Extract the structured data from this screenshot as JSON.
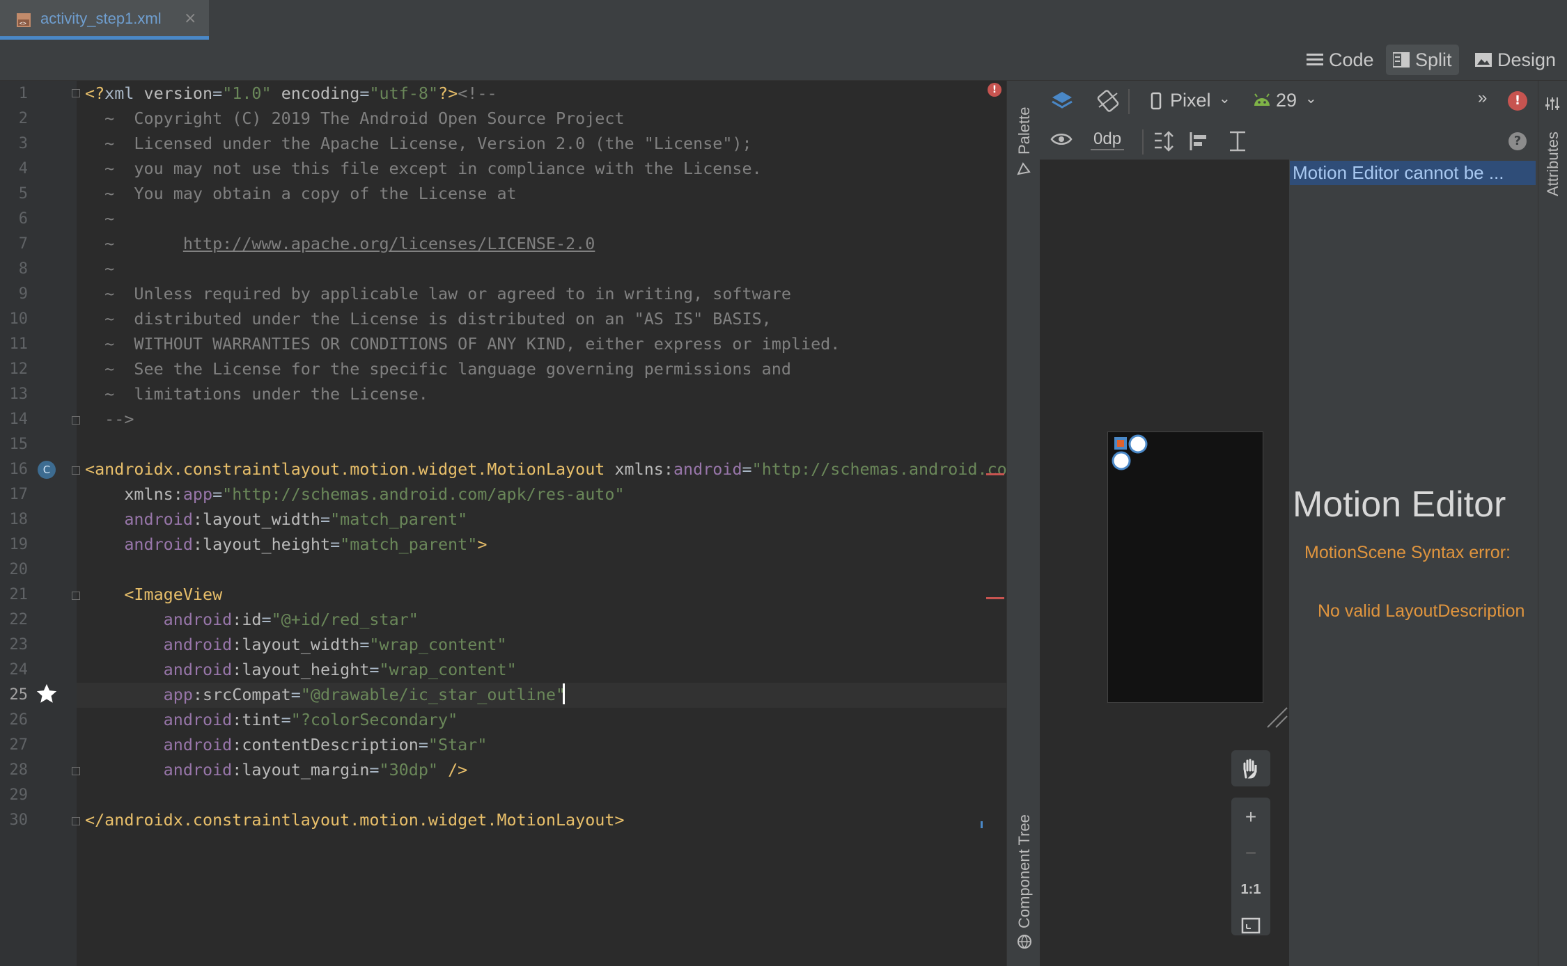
{
  "tab": {
    "filename": "activity_step1.xml",
    "close_icon": "×"
  },
  "modes": {
    "code": "Code",
    "split": "Split",
    "design": "Design"
  },
  "editor": {
    "line_numbers": [
      "1",
      "2",
      "3",
      "4",
      "5",
      "6",
      "7",
      "8",
      "9",
      "10",
      "11",
      "12",
      "13",
      "14",
      "15",
      "16",
      "17",
      "18",
      "19",
      "20",
      "21",
      "22",
      "23",
      "24",
      "25",
      "26",
      "27",
      "28",
      "29",
      "30"
    ],
    "lines": [
      {
        "parts": [
          {
            "t": "<?",
            "c": "tg"
          },
          {
            "t": "xml ",
            "c": ""
          },
          {
            "t": "version",
            "c": "at"
          },
          {
            "t": "=",
            "c": ""
          },
          {
            "t": "\"1.0\"",
            "c": "st"
          },
          {
            "t": " encoding",
            "c": "at"
          },
          {
            "t": "=",
            "c": ""
          },
          {
            "t": "\"utf-8\"",
            "c": "st"
          },
          {
            "t": "?>",
            "c": "tg"
          },
          {
            "t": "<!--",
            "c": "cm"
          }
        ]
      },
      {
        "parts": [
          {
            "t": "  ~  Copyright (C) 2019 The Android Open Source Project",
            "c": "cm"
          }
        ]
      },
      {
        "parts": [
          {
            "t": "  ~  Licensed under the Apache License, Version 2.0 (the \"License\");",
            "c": "cm"
          }
        ]
      },
      {
        "parts": [
          {
            "t": "  ~  you may not use this file except in compliance with the License.",
            "c": "cm"
          }
        ]
      },
      {
        "parts": [
          {
            "t": "  ~  You may obtain a copy of the License at",
            "c": "cm"
          }
        ]
      },
      {
        "parts": [
          {
            "t": "  ~",
            "c": "cm"
          }
        ]
      },
      {
        "parts": [
          {
            "t": "  ~       ",
            "c": "cm"
          },
          {
            "t": "http://www.apache.org/licenses/LICENSE-2.0",
            "c": "lk"
          }
        ]
      },
      {
        "parts": [
          {
            "t": "  ~",
            "c": "cm"
          }
        ]
      },
      {
        "parts": [
          {
            "t": "  ~  Unless required by applicable law or agreed to in writing, software",
            "c": "cm"
          }
        ]
      },
      {
        "parts": [
          {
            "t": "  ~  distributed under the License is distributed on an \"AS IS\" BASIS,",
            "c": "cm"
          }
        ]
      },
      {
        "parts": [
          {
            "t": "  ~  WITHOUT WARRANTIES OR CONDITIONS OF ANY KIND, either express or implied.",
            "c": "cm"
          }
        ]
      },
      {
        "parts": [
          {
            "t": "  ~  See the License for the specific language governing permissions and",
            "c": "cm"
          }
        ]
      },
      {
        "parts": [
          {
            "t": "  ~  limitations under the License.",
            "c": "cm"
          }
        ]
      },
      {
        "parts": [
          {
            "t": "  -->",
            "c": "cm"
          }
        ]
      },
      {
        "parts": [
          {
            "t": "",
            "c": ""
          }
        ]
      },
      {
        "parts": [
          {
            "t": "<androidx.constraintlayout.motion.widget.MotionLayout",
            "c": "tg"
          },
          {
            "t": " xmlns:",
            "c": "at"
          },
          {
            "t": "android",
            "c": "ns"
          },
          {
            "t": "=",
            "c": ""
          },
          {
            "t": "\"http://schemas.android.com",
            "c": "st"
          }
        ]
      },
      {
        "parts": [
          {
            "t": "    xmlns:",
            "c": "at"
          },
          {
            "t": "app",
            "c": "ns"
          },
          {
            "t": "=",
            "c": ""
          },
          {
            "t": "\"http://schemas.android.com/apk/res-auto\"",
            "c": "st"
          }
        ]
      },
      {
        "parts": [
          {
            "t": "    android",
            "c": "ns"
          },
          {
            "t": ":layout_width",
            "c": "at"
          },
          {
            "t": "=",
            "c": ""
          },
          {
            "t": "\"match_parent\"",
            "c": "st"
          }
        ]
      },
      {
        "parts": [
          {
            "t": "    android",
            "c": "ns"
          },
          {
            "t": ":layout_height",
            "c": "at"
          },
          {
            "t": "=",
            "c": ""
          },
          {
            "t": "\"match_parent\"",
            "c": "st"
          },
          {
            "t": ">",
            "c": "tg"
          }
        ]
      },
      {
        "parts": [
          {
            "t": "",
            "c": ""
          }
        ]
      },
      {
        "parts": [
          {
            "t": "    <ImageView",
            "c": "tg"
          }
        ]
      },
      {
        "parts": [
          {
            "t": "        android",
            "c": "ns"
          },
          {
            "t": ":id",
            "c": "at"
          },
          {
            "t": "=",
            "c": ""
          },
          {
            "t": "\"@+id/red_star\"",
            "c": "st"
          }
        ]
      },
      {
        "parts": [
          {
            "t": "        android",
            "c": "ns"
          },
          {
            "t": ":layout_width",
            "c": "at"
          },
          {
            "t": "=",
            "c": ""
          },
          {
            "t": "\"wrap_content\"",
            "c": "st"
          }
        ]
      },
      {
        "parts": [
          {
            "t": "        android",
            "c": "ns"
          },
          {
            "t": ":layout_height",
            "c": "at"
          },
          {
            "t": "=",
            "c": ""
          },
          {
            "t": "\"wrap_content\"",
            "c": "st"
          }
        ]
      },
      {
        "parts": [
          {
            "t": "        app",
            "c": "ns"
          },
          {
            "t": ":srcCompat",
            "c": "at"
          },
          {
            "t": "=",
            "c": ""
          },
          {
            "t": "\"@drawable/ic_star_outline\"",
            "c": "st"
          }
        ]
      },
      {
        "parts": [
          {
            "t": "        android",
            "c": "ns"
          },
          {
            "t": ":tint",
            "c": "at"
          },
          {
            "t": "=",
            "c": ""
          },
          {
            "t": "\"?colorSecondary\"",
            "c": "st"
          }
        ]
      },
      {
        "parts": [
          {
            "t": "        android",
            "c": "ns"
          },
          {
            "t": ":contentDescription",
            "c": "at"
          },
          {
            "t": "=",
            "c": ""
          },
          {
            "t": "\"Star\"",
            "c": "st"
          }
        ]
      },
      {
        "parts": [
          {
            "t": "        android",
            "c": "ns"
          },
          {
            "t": ":layout_margin",
            "c": "at"
          },
          {
            "t": "=",
            "c": ""
          },
          {
            "t": "\"30dp\"",
            "c": "st"
          },
          {
            "t": " />",
            "c": "tg"
          }
        ]
      },
      {
        "parts": [
          {
            "t": "",
            "c": ""
          }
        ]
      },
      {
        "parts": [
          {
            "t": "</androidx.constraintlayout.motion.widget.MotionLayout>",
            "c": "tg"
          }
        ]
      }
    ]
  },
  "side_panels": {
    "palette": "Palette",
    "component_tree": "Component Tree",
    "attributes": "Attributes"
  },
  "design_toolbar": {
    "device": "Pixel",
    "api_level": "29",
    "margin": "0dp",
    "help": "?"
  },
  "motion_editor": {
    "banner": "Motion Editor cannot be ...",
    "title": "Motion Editor",
    "error_heading": "MotionScene Syntax error:",
    "error_detail": "No valid LayoutDescription"
  },
  "zoom_controls": {
    "pan": "pan-icon",
    "zoom_in": "+",
    "zoom_out": "−",
    "actual_size": "1:1",
    "fit": "fit-screen-icon"
  },
  "colors": {
    "accent": "#4a88c7",
    "error": "#c75450",
    "warning_text": "#e0953e",
    "android_green": "#7fb347"
  }
}
